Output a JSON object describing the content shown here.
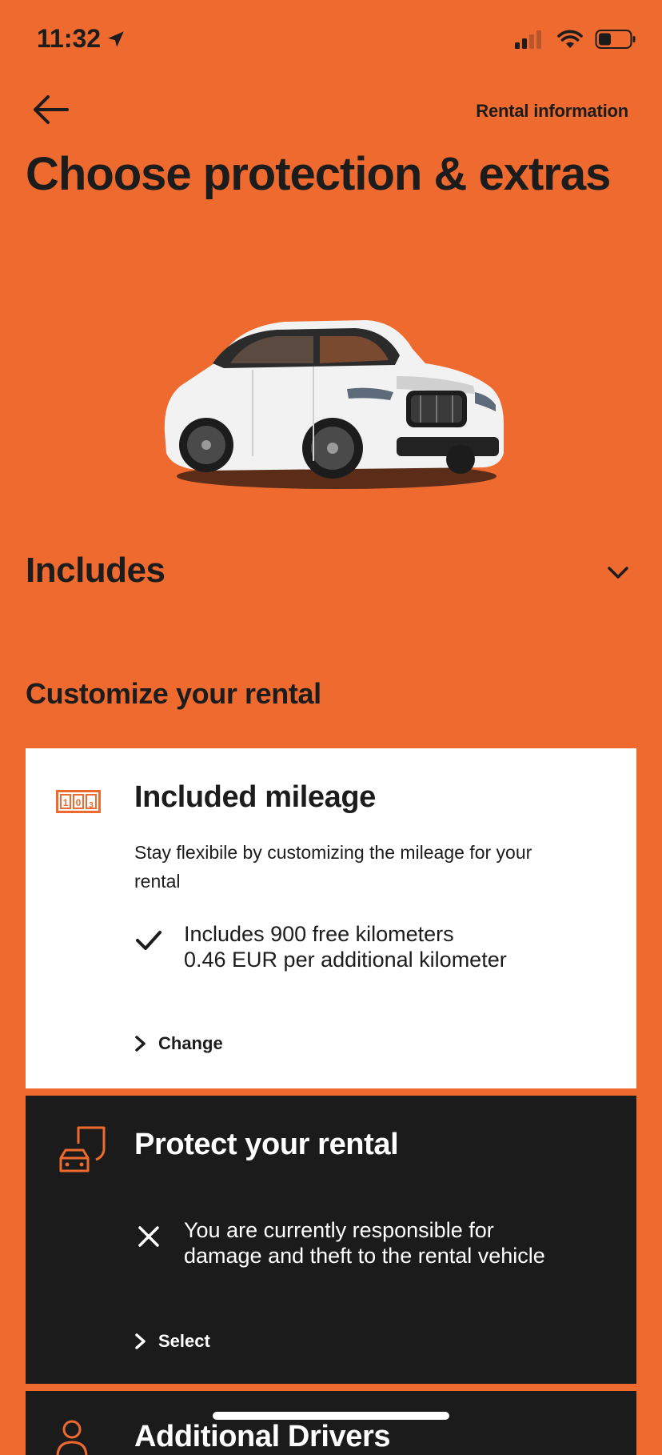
{
  "status_bar": {
    "time": "11:32"
  },
  "header": {
    "rental_info_label": "Rental information",
    "title": "Choose protection & extras"
  },
  "includes": {
    "label": "Includes"
  },
  "customize": {
    "heading": "Customize your rental"
  },
  "mileage_card": {
    "icon": "odometer-icon",
    "icon_digits": [
      "1",
      "0",
      "3"
    ],
    "title": "Included mileage",
    "description": "Stay flexibile by customizing the mileage for your rental",
    "feature_line_1": "Includes 900 free kilometers",
    "feature_line_2": "0.46 EUR per additional kilometer",
    "action_label": "Change"
  },
  "protect_card": {
    "icon": "car-shield-icon",
    "title": "Protect your rental",
    "feature_line_1": "You are currently responsible for",
    "feature_line_2": "damage and theft to the rental vehicle",
    "action_label": "Select"
  },
  "drivers_card": {
    "icon": "person-icon",
    "title": "Additional Drivers"
  },
  "colors": {
    "background": "#ee6a2f",
    "accent": "#ee6a2f",
    "card_light": "#ffffff",
    "card_dark": "#1c1b1b",
    "text_dark": "#1c1c1c"
  }
}
